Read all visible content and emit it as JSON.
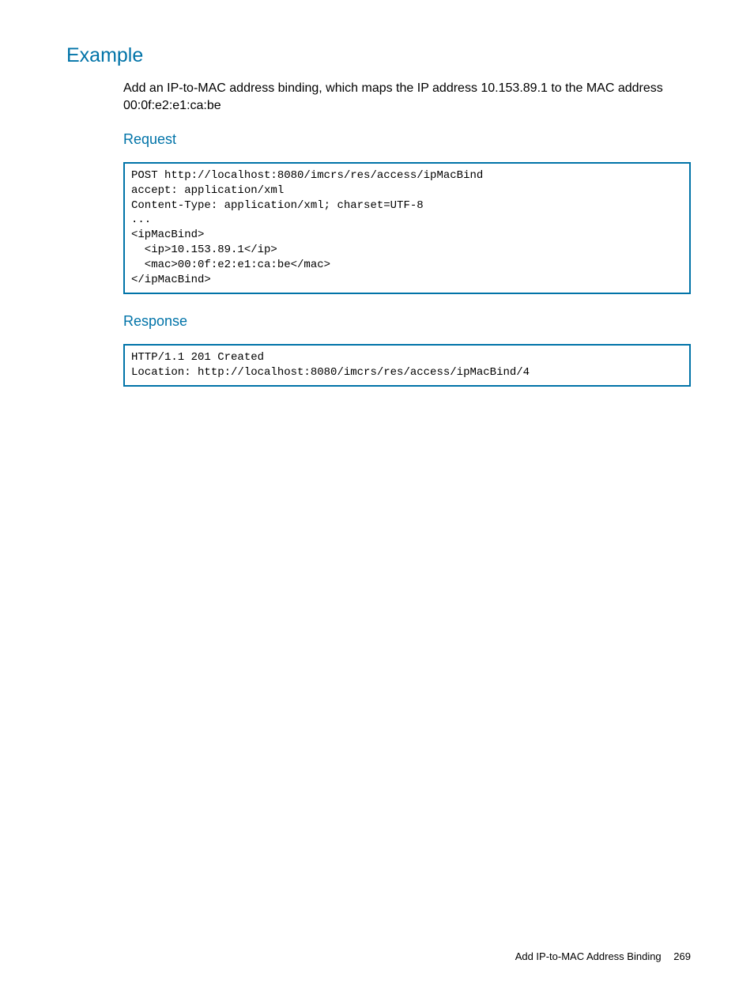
{
  "headings": {
    "example": "Example",
    "request": "Request",
    "response": "Response"
  },
  "description": "Add an IP-to-MAC address binding, which maps the IP address 10.153.89.1 to the MAC address 00:0f:e2:e1:ca:be",
  "request_code": "POST http://localhost:8080/imcrs/res/access/ipMacBind\naccept: application/xml\nContent-Type: application/xml; charset=UTF-8\n...\n<ipMacBind>\n  <ip>10.153.89.1</ip>\n  <mac>00:0f:e2:e1:ca:be</mac>\n</ipMacBind>",
  "response_code": "HTTP/1.1 201 Created\nLocation: http://localhost:8080/imcrs/res/access/ipMacBind/4",
  "footer": {
    "title": "Add IP-to-MAC Address Binding",
    "page_number": "269"
  }
}
